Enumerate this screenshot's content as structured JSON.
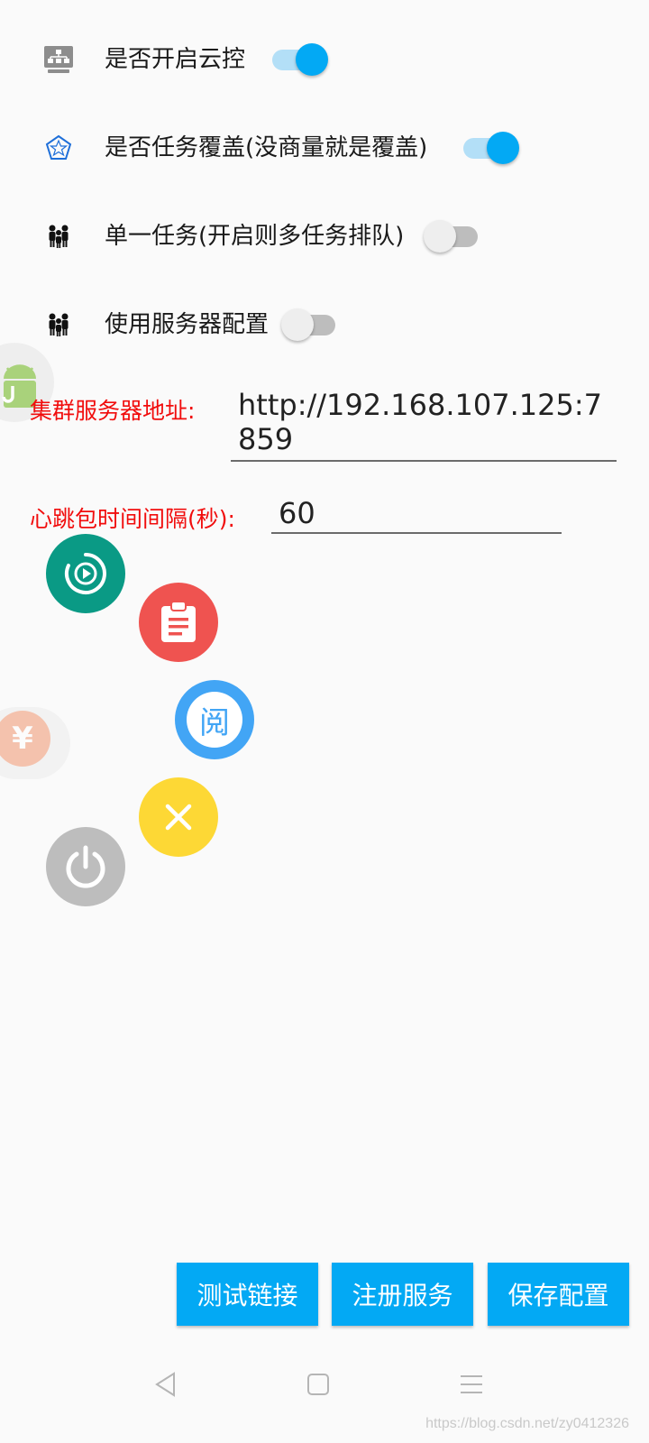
{
  "settings": [
    {
      "label": "是否开启云控",
      "icon": "server-network-icon",
      "enabled": true
    },
    {
      "label": "是否任务覆盖(没商量就是覆盖)",
      "icon": "pentagon-star-icon",
      "enabled": true
    },
    {
      "label": "单一任务(开启则多任务排队)",
      "icon": "people-group-icon",
      "enabled": false
    },
    {
      "label": "使用服务器配置",
      "icon": "people-group-icon",
      "enabled": false
    }
  ],
  "cluster_server": {
    "label": "集群服务器地址:",
    "value": "http://192.168.107.125:7859"
  },
  "heartbeat": {
    "label": "心跳包时间间隔(秒):",
    "value": "60"
  },
  "floating_menu": {
    "read_glyph": "阅",
    "yen_glyph": "¥",
    "items": [
      "play-circle-icon",
      "clipboard-icon",
      "read-icon",
      "close-icon",
      "power-icon"
    ]
  },
  "buttons": {
    "test": "测试链接",
    "register": "注册服务",
    "save": "保存配置"
  },
  "watermark": "https://blog.csdn.net/zy0412326",
  "colors": {
    "accent": "#03a9f4",
    "label_red": "#f10d0d",
    "fab_teal": "#0a9a85",
    "fab_red": "#ef5350",
    "fab_blue": "#42a5f5",
    "fab_yellow": "#fdd835",
    "fab_grey": "#bdbdbd"
  }
}
